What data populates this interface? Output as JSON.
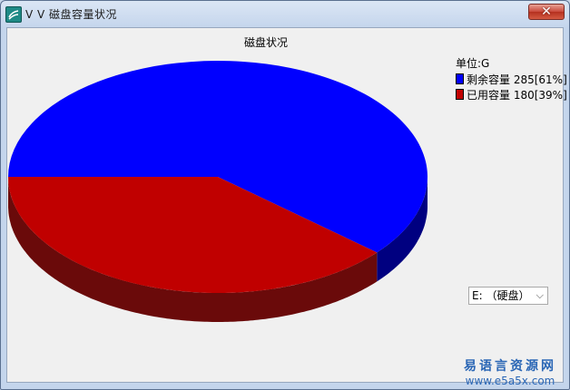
{
  "window": {
    "title": "V V 磁盘容量状况",
    "close_label": "✕",
    "app_icon": "app-logo-icon",
    "close_icon": "close-icon"
  },
  "chart": {
    "title": "磁盘状况",
    "unit_label": "单位:G"
  },
  "legend": [
    {
      "label": "剩余容量 285[61%]",
      "color": "#0000ff"
    },
    {
      "label": "已用容量 180[39%]",
      "color": "#c00000"
    }
  ],
  "drive_select": {
    "selected": "E: （硬盘）",
    "chevron_icon": "chevron-down-icon"
  },
  "watermark": {
    "cn": "易语言资源网",
    "en": "www.e5a5x.com"
  },
  "chart_data": {
    "type": "pie",
    "title": "磁盘状况",
    "unit": "G",
    "slices": [
      {
        "label": "剩余容量",
        "value": 285,
        "percent": 61,
        "color": "#0000ff",
        "side_color": "#000080"
      },
      {
        "label": "已用容量",
        "value": 180,
        "percent": 39,
        "color": "#c00000",
        "side_color": "#6a0a0a"
      }
    ],
    "legend_position": "top-right",
    "style": "3d"
  }
}
